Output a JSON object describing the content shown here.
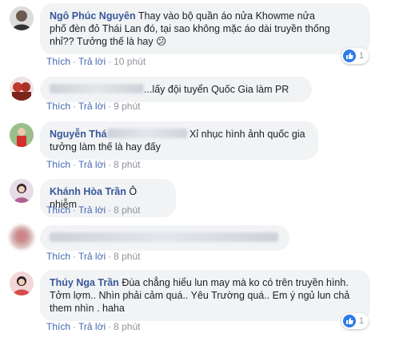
{
  "labels": {
    "like": "Thích",
    "reply": "Trả lời"
  },
  "colors": {
    "author": "#385898",
    "link": "#4267b2",
    "bubble": "#f2f3f5",
    "reaction": "#2e7ae8"
  },
  "comments": [
    {
      "author": "Ngô Phúc Nguyên",
      "text": "Thay vào bộ quần áo nửa Khowme nửa phố đèn đỏ Thái Lan đó, tại sao không mặc áo dài truyền thống nhỉ?? Tưởng thế là hay 😕",
      "time": "10 phút",
      "reactions": "1"
    },
    {
      "author": "",
      "text": "...lấy đội tuyển Quốc Gia làm PR",
      "time": "9 phút"
    },
    {
      "author": "Nguyễn Thá",
      "text": "Xỉ nhục hình ảnh quốc gia tưởng làm thế là hay đấy",
      "time": "8 phút"
    },
    {
      "author": "Khánh Hòa Trần",
      "text": "Ô nhiễm",
      "time": "8 phút"
    },
    {
      "author": "",
      "text": "",
      "time": "8 phút"
    },
    {
      "author": "Thúy Nga Trần",
      "text": "Đùa chẳng hiểu lun may mà ko có trên truyền hình. Tởm lợm.. Nhìn phải cảm quá.. Yêu Trường quá.. Em ý ngủ lun chả them nhìn . haha",
      "time": "8 phút",
      "reactions": "1"
    }
  ]
}
